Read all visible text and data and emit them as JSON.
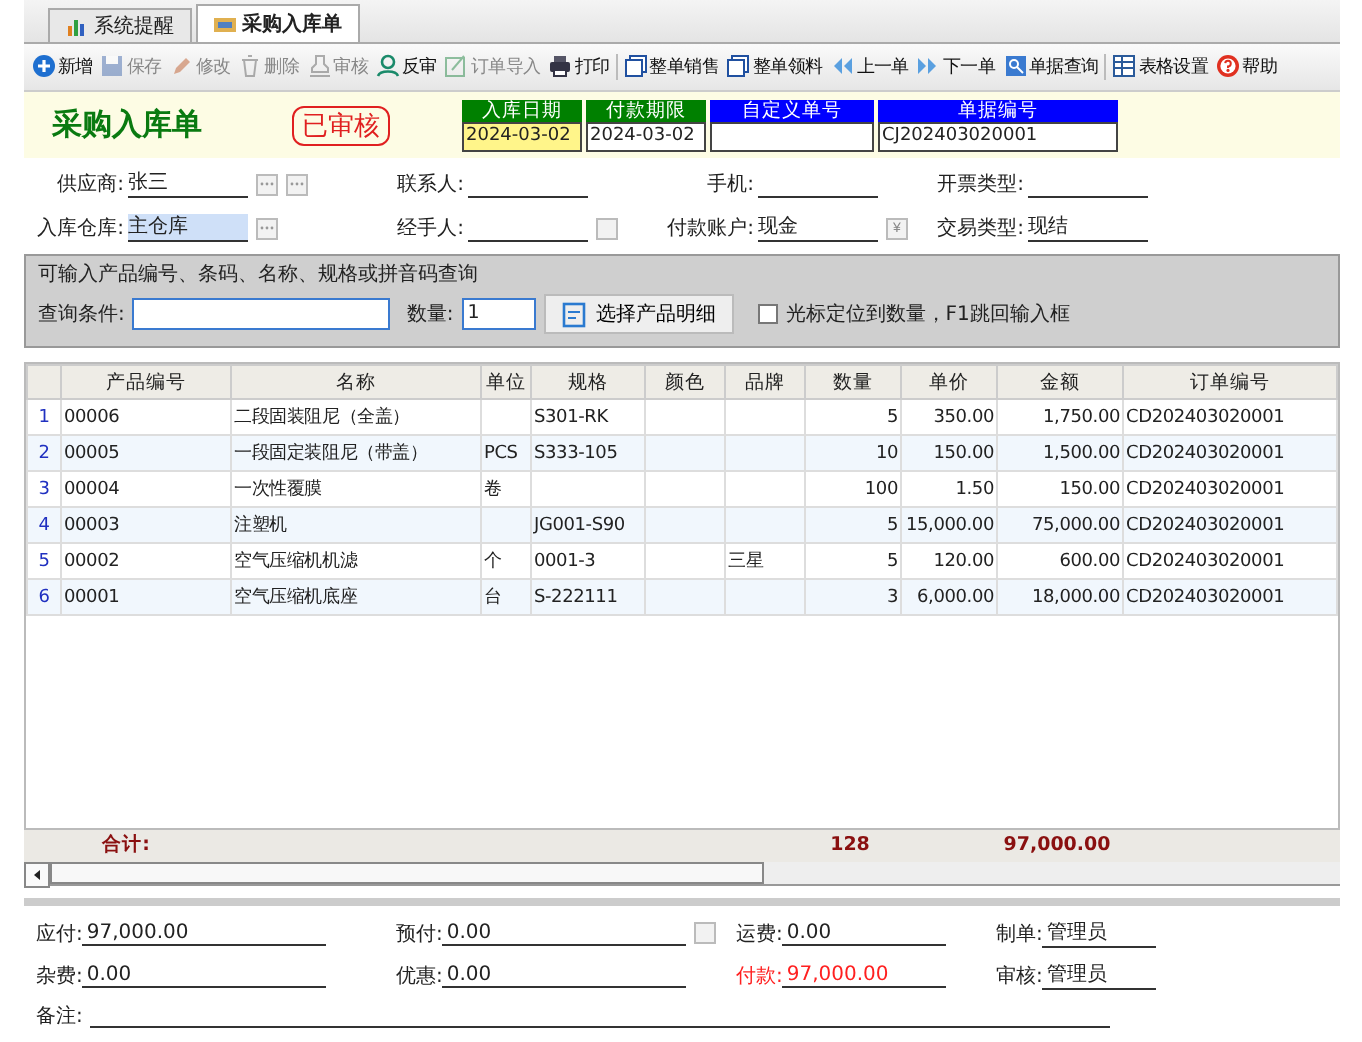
{
  "tabs": [
    {
      "label": "系统提醒",
      "selected": false
    },
    {
      "label": "采购入库单",
      "selected": true
    }
  ],
  "toolbar": [
    [
      {
        "label": "新增",
        "disabled": false
      },
      {
        "label": "保存",
        "disabled": true
      },
      {
        "label": "修改",
        "disabled": true
      },
      {
        "label": "删除",
        "disabled": true
      },
      {
        "label": "审核",
        "disabled": true
      },
      {
        "label": "反审",
        "disabled": false
      },
      {
        "label": "订单导入",
        "disabled": true
      },
      {
        "label": "打印",
        "disabled": false
      }
    ],
    [
      {
        "label": "整单销售",
        "disabled": false
      },
      {
        "label": "整单领料",
        "disabled": false
      },
      {
        "label": "上一单",
        "disabled": false
      },
      {
        "label": "下一单",
        "disabled": false
      },
      {
        "label": "单据查询",
        "disabled": false
      }
    ],
    [
      {
        "label": "表格设置",
        "disabled": false
      },
      {
        "label": "帮助",
        "disabled": false
      }
    ]
  ],
  "header": {
    "title": "采购入库单",
    "stamp": "已审核",
    "fields": [
      {
        "label": "入库日期",
        "color": "#008000",
        "value": "2024-03-02",
        "highlighted": true
      },
      {
        "label": "付款期限",
        "color": "#008000",
        "value": "2024-03-02",
        "highlighted": false
      },
      {
        "label": "自定义单号",
        "color": "#0000ff",
        "highlighted": false
      },
      {
        "label": "单据编号",
        "color": "#0000ff",
        "value": "CJ202403020001",
        "highlighted": false
      }
    ]
  },
  "form_rows": [
    [
      {
        "label": "供应商:",
        "value": "张三",
        "selected": false,
        "pickers": [
          {
            "kind": "dots"
          },
          {
            "kind": "dots"
          }
        ]
      },
      {
        "label": "联系人:"
      },
      {
        "label": "手机:"
      },
      {
        "label": "开票类型:"
      }
    ],
    [
      {
        "label": "入库仓库:",
        "value": "主仓库",
        "selected": true,
        "pickers": [
          {
            "kind": "dots"
          }
        ]
      },
      {
        "label": "经手人:",
        "pickers": [
          {
            "kind": "plain"
          }
        ]
      },
      {
        "label": "付款账户:",
        "value": "现金",
        "selected": false,
        "pickers": [
          {
            "kind": "text",
            "label": "¥"
          }
        ]
      },
      {
        "label": "交易类型:",
        "value": "现结",
        "selected": false
      }
    ]
  ],
  "query": {
    "legend": "可输入产品编号、条码、名称、规格或拼音码查询",
    "condition_label": "查询条件:",
    "quantity_label": "数量:",
    "quantity": "1",
    "button": "选择产品明细",
    "checkbox": {
      "label": "光标定位到数量，F1跳回输入框",
      "checked": false
    }
  },
  "table": {
    "columns": [
      {
        "kind": "index"
      },
      {
        "label": "产品编号",
        "kind": "text"
      },
      {
        "label": "名称",
        "kind": "text"
      },
      {
        "label": "单位",
        "kind": "text"
      },
      {
        "label": "规格",
        "kind": "text"
      },
      {
        "label": "颜色",
        "kind": "text"
      },
      {
        "label": "品牌",
        "kind": "text"
      },
      {
        "label": "数量",
        "kind": "number"
      },
      {
        "label": "单价",
        "kind": "number"
      },
      {
        "label": "金额",
        "kind": "number"
      },
      {
        "label": "订单编号",
        "kind": "text"
      }
    ],
    "rows": [
      [
        "1",
        "00006",
        "二段固装阻尼（全盖）",
        "",
        "S301-RK",
        "",
        "",
        "5",
        "350.00",
        "1,750.00",
        "CD202403020001"
      ],
      [
        "2",
        "00005",
        "一段固定装阻尼（带盖）",
        "PCS",
        "S333-105",
        "",
        "",
        "10",
        "150.00",
        "1,500.00",
        "CD202403020001"
      ],
      [
        "3",
        "00004",
        "一次性覆膜",
        "卷",
        "",
        "",
        "",
        "100",
        "1.50",
        "150.00",
        "CD202403020001"
      ],
      [
        "4",
        "00003",
        "注塑机",
        "",
        "JG001-S90",
        "",
        "",
        "5",
        "15,000.00",
        "75,000.00",
        "CD202403020001"
      ],
      [
        "5",
        "00002",
        "空气压缩机机滤",
        "个",
        "0001-3",
        "",
        "三星",
        "5",
        "120.00",
        "600.00",
        "CD202403020001"
      ],
      [
        "6",
        "00001",
        "空气压缩机底座",
        "台",
        "S-222111",
        "",
        "",
        "3",
        "6,000.00",
        "18,000.00",
        "CD202403020001"
      ]
    ],
    "totals": {
      "label": "合计:",
      "quantity": "128",
      "amount": "97,000.00"
    }
  },
  "summary": [
    [
      {
        "label": "应付:",
        "value": "97,000.00",
        "alert": false
      },
      {
        "label": "预付:",
        "value": "0.00",
        "alert": false,
        "button": true
      },
      {
        "label": "运费:",
        "value": "0.00",
        "alert": false
      },
      {
        "label": "制单:",
        "value": "管理员",
        "alert": false
      }
    ],
    [
      {
        "label": "杂费:",
        "value": "0.00",
        "alert": false
      },
      {
        "label": "优惠:",
        "value": "0.00",
        "alert": false
      },
      {
        "label": "付款:",
        "value": "97,000.00",
        "alert": true
      },
      {
        "label": "审核:",
        "value": "管理员",
        "alert": false
      }
    ]
  ],
  "remark": {
    "label": "备注:"
  }
}
